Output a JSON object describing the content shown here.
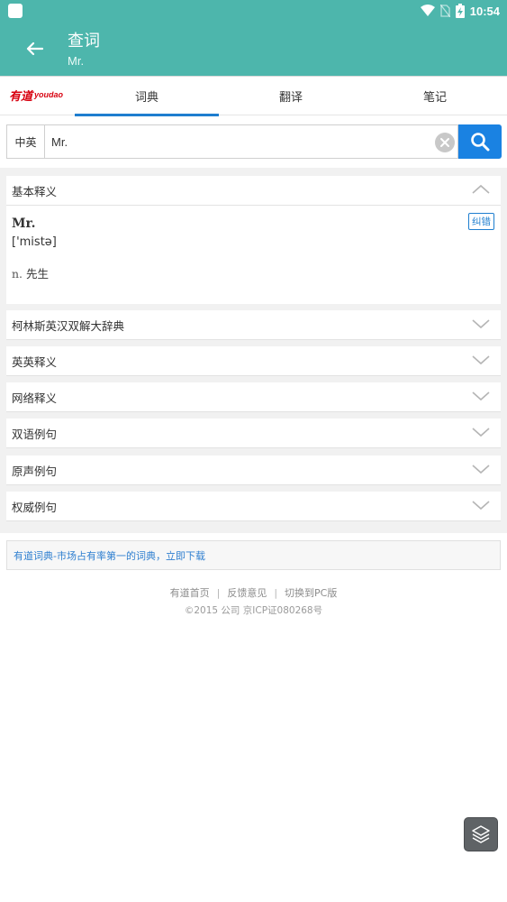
{
  "status_bar": {
    "time": "10:54",
    "icons": [
      "notification-square-icon",
      "wifi-icon",
      "no-sim-icon",
      "battery-charging-icon"
    ]
  },
  "app_bar": {
    "title": "查词",
    "subtitle": "Mr.",
    "back_icon": "back-arrow-icon"
  },
  "tabs": {
    "logo_cn": "有道",
    "logo_en": "youdao",
    "items": [
      {
        "label": "词典",
        "active": true
      },
      {
        "label": "翻译",
        "active": false
      },
      {
        "label": "笔记",
        "active": false
      }
    ]
  },
  "search": {
    "lang": "中英",
    "query": "Mr.",
    "clear_icon": "clear-icon",
    "search_icon": "search-icon"
  },
  "basic": {
    "header": "基本释义",
    "word": "Mr.",
    "phonetic": "['mistə]",
    "pos": "n.",
    "meaning": "先生",
    "report_label": "纠错"
  },
  "sections": [
    {
      "label": "柯林斯英汉双解大辞典"
    },
    {
      "label": "英英释义"
    },
    {
      "label": "网络释义"
    },
    {
      "label": "双语例句"
    },
    {
      "label": "原声例句"
    },
    {
      "label": "权威例句"
    }
  ],
  "promo": "有道词典-市场占有率第一的词典，立即下载",
  "footer": {
    "links": [
      "有道首页",
      "反馈意见",
      "切换到PC版"
    ],
    "separator": "|",
    "copyright": "©2015 公司 京ICP证080268号"
  },
  "colors": {
    "app_bar": "#4db6ac",
    "accent": "#1e7ecf",
    "search_button": "#1a82e2",
    "logo_red": "#d8000f"
  }
}
